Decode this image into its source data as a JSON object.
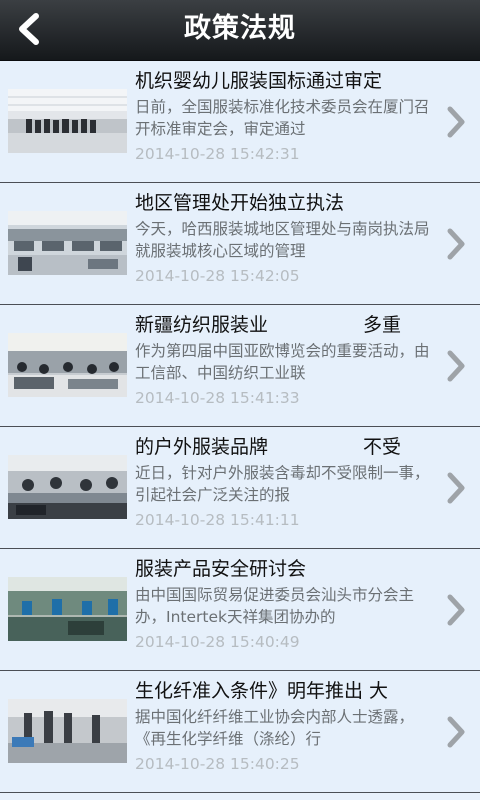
{
  "header": {
    "title": "政策法规"
  },
  "news": [
    {
      "title": "机织婴幼儿服装国标通过审定",
      "summary": "日前，全国服装标准化技术委员会在厦门召开标准审定会，审定通过",
      "date": "2014-10-28 15:42:31"
    },
    {
      "title": "地区管理处开始独立执法",
      "summary": "今天，哈西服装城地区管理处与南岗执法局就服装城核心区域的管理",
      "date": "2014-10-28 15:42:05"
    },
    {
      "title": "新疆纺织服装业　　　　　多重",
      "summary": "作为第四届中国亚欧博览会的重要活动，由工信部、中国纺织工业联",
      "date": "2014-10-28 15:41:33"
    },
    {
      "title": "的户外服装品牌　　　　　不受",
      "summary": "近日，针对户外服装含毒却不受限制一事，引起社会广泛关注的报",
      "date": "2014-10-28 15:41:11"
    },
    {
      "title": "服装产品安全研讨会",
      "summary": "由中国国际贸易促进委员会汕头市分会主办，Intertek天祥集团协办的",
      "date": "2014-10-28 15:40:49"
    },
    {
      "title": "生化纤准入条件》明年推出 大",
      "summary": "据中国化纤纤维工业协会内部人士透露，《再生化学纤维（涤纶）行",
      "date": "2014-10-28 15:40:25"
    }
  ]
}
